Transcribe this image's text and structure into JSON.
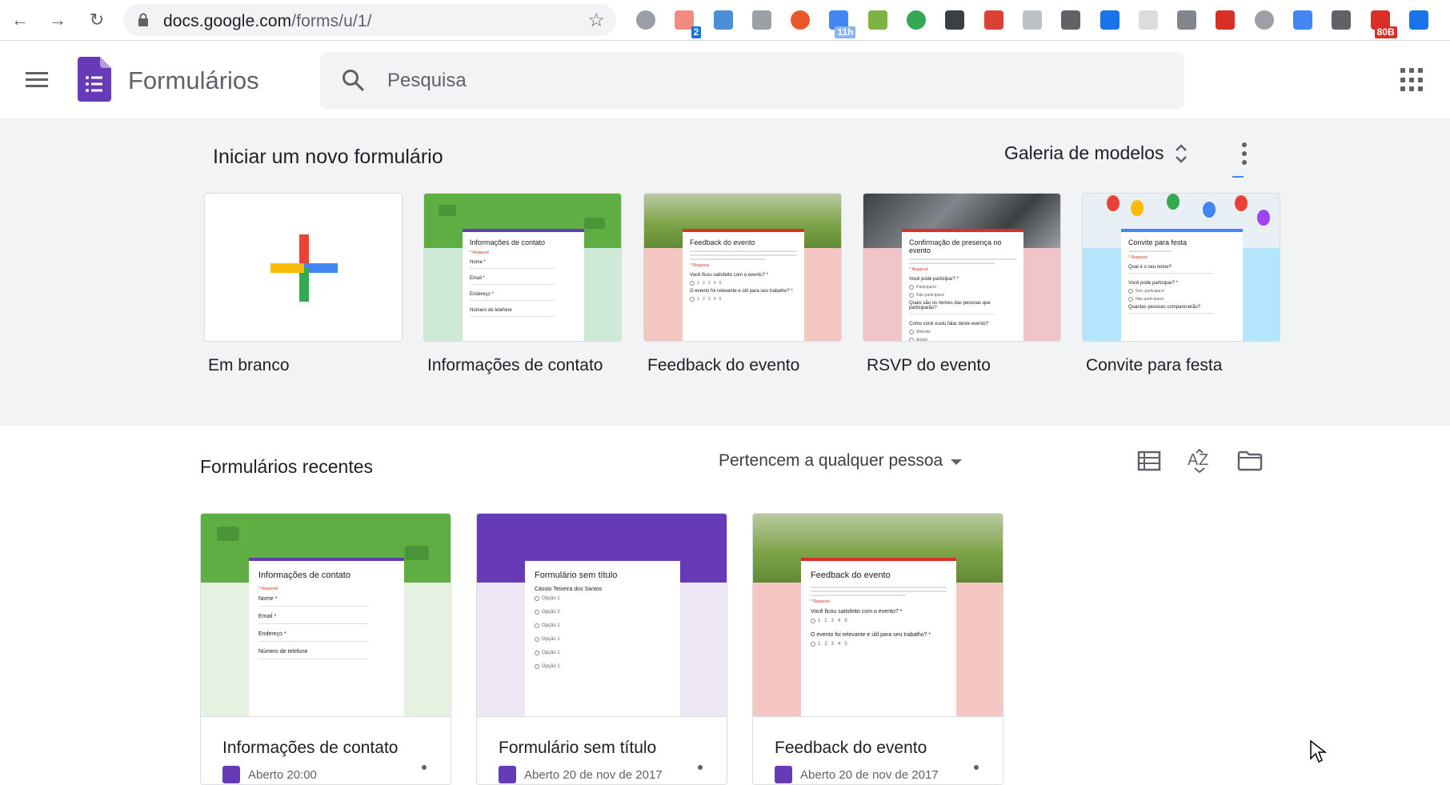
{
  "browser": {
    "url_host": "docs.google.com",
    "url_path": "/forms/u/1/",
    "extensions": [
      {
        "icon": "lightbulb-icon",
        "color": "#9aa0a6"
      },
      {
        "icon": "workflow-icon",
        "color": "#f28b82",
        "badge": "2",
        "badge_color": "#1a73e8"
      },
      {
        "icon": "code-book-icon",
        "color": "#4a8ed8"
      },
      {
        "icon": "code-icon",
        "color": "#9aa0a6"
      },
      {
        "icon": "b-logo-icon",
        "color": "#e8572a"
      },
      {
        "icon": "calendar-icon",
        "color": "#4285f4",
        "badge": "11h",
        "badge_color": "#8ab4f8"
      },
      {
        "icon": "money-icon",
        "color": "#7cb342"
      },
      {
        "icon": "compass-icon",
        "color": "#34a853"
      },
      {
        "icon": "bulb-dark-icon",
        "color": "#3c4043"
      },
      {
        "icon": "todoist-icon",
        "color": "#db4035"
      },
      {
        "icon": "briefcase-icon",
        "color": "#bdc1c6"
      },
      {
        "icon": "pocket-icon",
        "color": "#5f6368"
      },
      {
        "icon": "eyedropper-icon",
        "color": "#1a73e8"
      },
      {
        "icon": "inbox-icon",
        "color": "#dadce0"
      },
      {
        "icon": "spy-icon",
        "color": "#80868b"
      },
      {
        "icon": "plus-cross-icon",
        "color": "#d93025"
      },
      {
        "icon": "e9-icon",
        "color": "#9aa0a6"
      },
      {
        "icon": "magnifier-icon",
        "color": "#4285f4"
      },
      {
        "icon": "link-icon",
        "color": "#5f6368"
      },
      {
        "icon": "mail-counter-icon",
        "color": "#d93025",
        "badge": "80B",
        "badge_color": "#d93025"
      },
      {
        "icon": "cast-icon",
        "color": "#1a73e8"
      }
    ]
  },
  "app": {
    "title": "Formulários",
    "search_placeholder": "Pesquisa"
  },
  "templates": {
    "heading": "Iniciar um novo formulário",
    "gallery_label": "Galeria de modelos",
    "items": [
      {
        "label": "Em branco"
      },
      {
        "label": "Informações de contato",
        "form_title": "Informações de contato",
        "bg": "#ceead6",
        "header": "#5fae43"
      },
      {
        "label": "Feedback do evento",
        "form_title": "Feedback do evento",
        "bg": "#f4c7c3",
        "header": "#8fb359"
      },
      {
        "label": "RSVP do evento",
        "form_title": "Confirmação de presença no evento",
        "bg": "#f0c4c8",
        "header": "#5a5e66"
      },
      {
        "label": "Convite para festa",
        "form_title": "Convite para festa",
        "bg": "#b3e5fc",
        "header": "#cfe3f0"
      }
    ]
  },
  "recent": {
    "heading": "Formulários recentes",
    "owner_filter": "Pertencem a qualquer pessoa",
    "items": [
      {
        "name": "Informações de contato",
        "form_title": "Informações de contato",
        "meta": "Aberto 20:00",
        "bg": "#e6f2e1",
        "header": "#5fae43"
      },
      {
        "name": "Formulário sem título",
        "form_title": "Formulário sem título",
        "meta": "Aberto 20 de nov de 2017",
        "bg": "#ede7f6",
        "header": "#673ab7"
      },
      {
        "name": "Feedback do evento",
        "form_title": "Feedback do evento",
        "meta": "Aberto 20 de nov de 2017",
        "bg": "#f4c7c3",
        "header": "#8fb359"
      }
    ]
  }
}
